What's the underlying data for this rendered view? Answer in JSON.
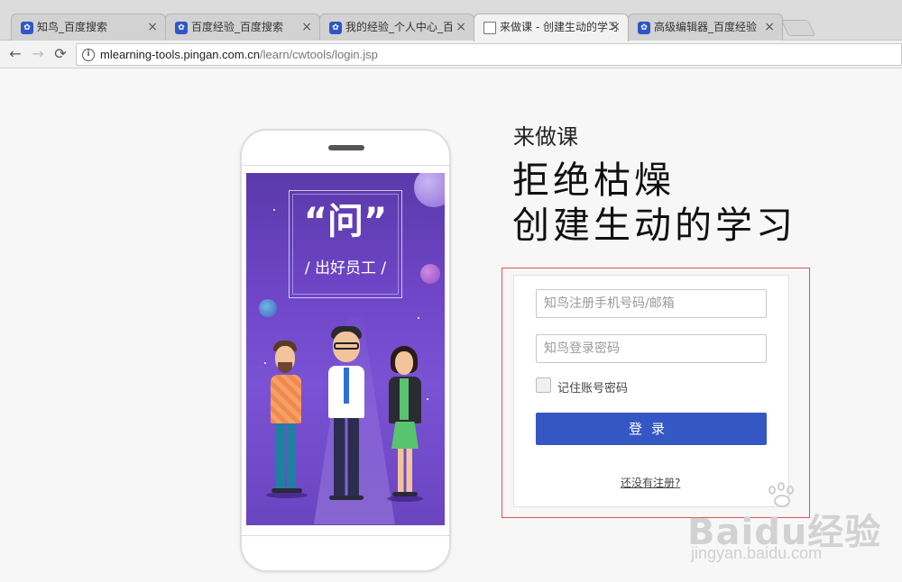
{
  "browser": {
    "tabs": [
      {
        "label": "知鸟_百度搜索",
        "favicon": "baidu-paw-icon",
        "close": "×"
      },
      {
        "label": "百度经验_百度搜索",
        "favicon": "baidu-paw-icon",
        "close": "×"
      },
      {
        "label": "我的经验_个人中心_百度",
        "favicon": "baidu-paw-icon",
        "close": "×"
      },
      {
        "label": "来做课 - 创建生动的学习",
        "favicon": "page-icon",
        "close": "×",
        "active": true
      },
      {
        "label": "高级编辑器_百度经验",
        "favicon": "baidu-paw-icon",
        "close": "×"
      }
    ],
    "url_host": "mlearning-tools.pingan.com.cn",
    "url_path": "/learn/cwtools/login.jsp",
    "nav": {
      "back": "←",
      "forward": "→",
      "reload": "⟳",
      "info": "i"
    }
  },
  "phone_screen": {
    "quote_title": "“问”",
    "quote_subtitle": "/ 出好员工 /"
  },
  "page": {
    "brand": "来做课",
    "headline_line1": "拒绝枯燥",
    "headline_line2": "创建生动的学习"
  },
  "login": {
    "username_placeholder": "知鸟注册手机号码/邮箱",
    "password_placeholder": "知鸟登录密码",
    "remember_label": "记住账号密码",
    "remember_checked": false,
    "submit_label": "登录",
    "register_link": "还没有注册?"
  },
  "watermark": {
    "logo": "Baidu经验",
    "url": "jingyan.baidu.com"
  },
  "colors": {
    "primary_button": "#3557c4",
    "highlight_border": "#e0524f",
    "phone_bg": "#6f46c8"
  }
}
